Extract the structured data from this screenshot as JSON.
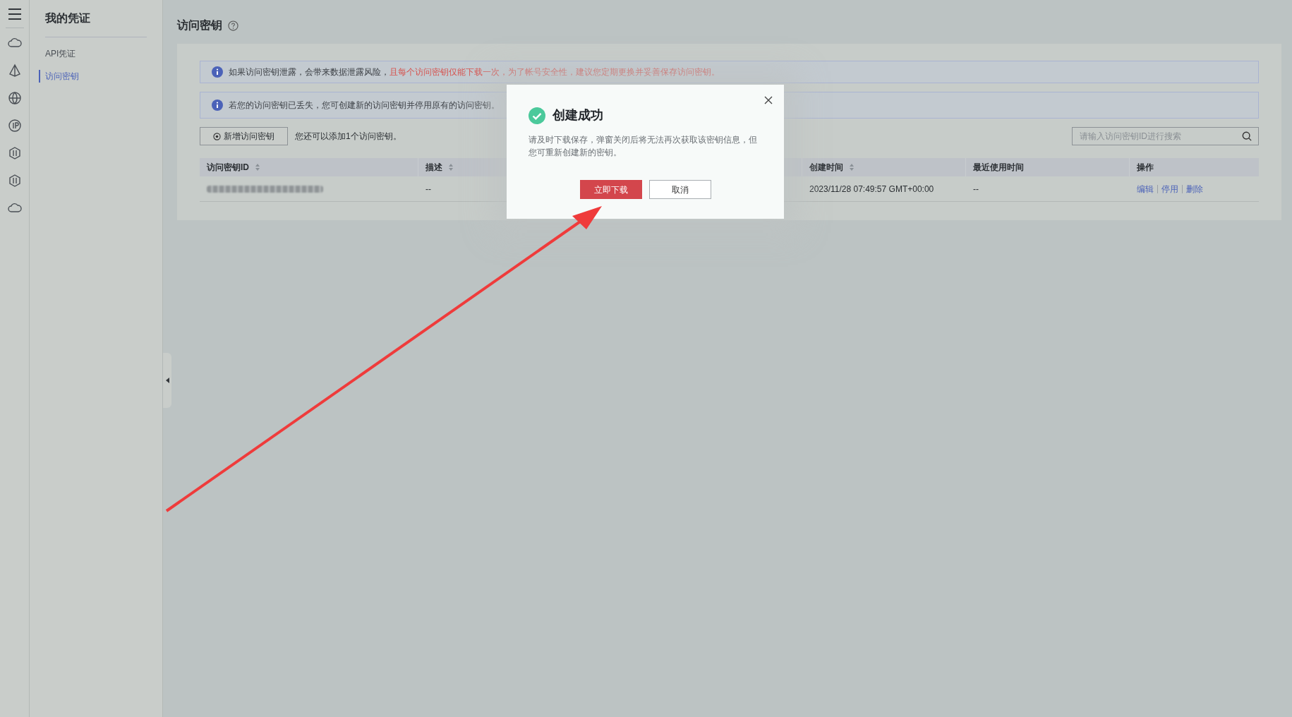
{
  "nav": {
    "title": "我的凭证",
    "items": [
      {
        "label": "API凭证",
        "selected": false
      },
      {
        "label": "访问密钥",
        "selected": true
      }
    ]
  },
  "page": {
    "title": "访问密钥"
  },
  "alerts": [
    {
      "parts": [
        {
          "kind": "normal",
          "text": "如果访问密钥泄露，会带来数据泄露风险，"
        },
        {
          "kind": "warning",
          "text": "且每个访问密钥仅能下载一次，为了帐号安全性，建议您定期更换并妥善保存访问密钥。"
        }
      ]
    },
    {
      "parts": [
        {
          "kind": "normal",
          "text": "若您的访问密钥已丢失，您可创建新的访问密钥并停用原有的访问密钥。"
        }
      ]
    }
  ],
  "toolbar": {
    "add_button": "新增访问密钥",
    "hint": "您还可以添加1个访问密钥。",
    "search": {
      "placeholder": "请输入访问密钥ID进行搜索"
    }
  },
  "table": {
    "columns": [
      {
        "label": "访问密钥ID",
        "sortable": true
      },
      {
        "label": "描述",
        "sortable": true
      },
      {
        "label": "创建时间",
        "sortable": true
      },
      {
        "label": "最近使用时间",
        "sortable": false
      },
      {
        "label": "操作",
        "sortable": false
      }
    ],
    "rows": [
      {
        "cells": [
          {
            "kind": "redacted"
          },
          {
            "kind": "text",
            "text": "--"
          },
          {
            "kind": "text",
            "text": "2023/11/28 07:49:57 GMT+00:00"
          },
          {
            "kind": "text",
            "text": "--"
          },
          {
            "kind": "actions",
            "actions": [
              "编辑",
              "停用",
              "删除"
            ]
          }
        ]
      }
    ]
  },
  "dialog": {
    "title": "创建成功",
    "message": "请及时下载保存，弹窗关闭后将无法再次获取该密钥信息，但您可重新创建新的密钥。",
    "buttons": [
      {
        "label": "立即下载",
        "primary": true
      },
      {
        "label": "取消",
        "primary": false
      }
    ]
  }
}
